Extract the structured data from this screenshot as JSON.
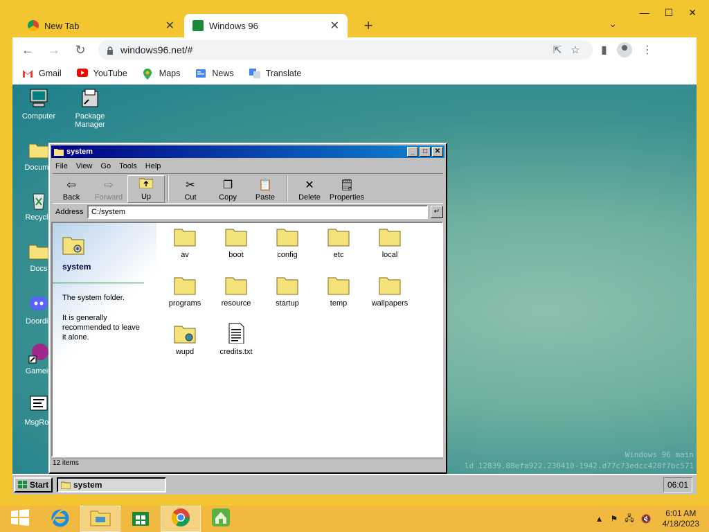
{
  "browser": {
    "tabs": [
      {
        "title": "New Tab",
        "active": false
      },
      {
        "title": "Windows 96",
        "active": true
      }
    ],
    "url": "windows96.net/#",
    "bookmarks": [
      {
        "label": "Gmail",
        "icon": "gmail-icon"
      },
      {
        "label": "YouTube",
        "icon": "youtube-icon"
      },
      {
        "label": "Maps",
        "icon": "maps-icon"
      },
      {
        "label": "News",
        "icon": "news-icon"
      },
      {
        "label": "Translate",
        "icon": "translate-icon"
      }
    ]
  },
  "desktop": {
    "icons": [
      {
        "label": "Computer"
      },
      {
        "label": "Package Manager"
      },
      {
        "label": "Docume"
      },
      {
        "label": "Recycle"
      },
      {
        "label": "Docs"
      },
      {
        "label": "Doordis"
      },
      {
        "label": "Gamein"
      },
      {
        "label": "MsgRoo"
      }
    ],
    "watermark_line1": "Windows 96 main",
    "watermark_line2": "ld 12839.88efa922.230410-1942.d77c73edcc428f7bc571"
  },
  "explorer": {
    "title": "system",
    "menu": [
      "File",
      "View",
      "Go",
      "Tools",
      "Help"
    ],
    "toolbar": {
      "back": "Back",
      "forward": "Forward",
      "up": "Up",
      "cut": "Cut",
      "copy": "Copy",
      "paste": "Paste",
      "delete": "Delete",
      "properties": "Properties"
    },
    "address_label": "Address",
    "address_value": "C:/system",
    "sidebar": {
      "title": "system",
      "desc": "The system folder.",
      "note": "It is generally recommended to leave it alone."
    },
    "files": [
      "av",
      "boot",
      "config",
      "etc",
      "local",
      "programs",
      "resource",
      "startup",
      "temp",
      "wallpapers",
      "wupd",
      "credits.txt"
    ],
    "status": "12 items"
  },
  "w96taskbar": {
    "start_label": "Start",
    "task_label": "system",
    "clock": "06:01"
  },
  "windows": {
    "time": "6:01 AM",
    "date": "4/18/2023"
  },
  "colors": {
    "accent": "#f2c531",
    "w96_title": "#000080",
    "w96_face": "#c0c0c0",
    "folder": "#f6e27a"
  }
}
